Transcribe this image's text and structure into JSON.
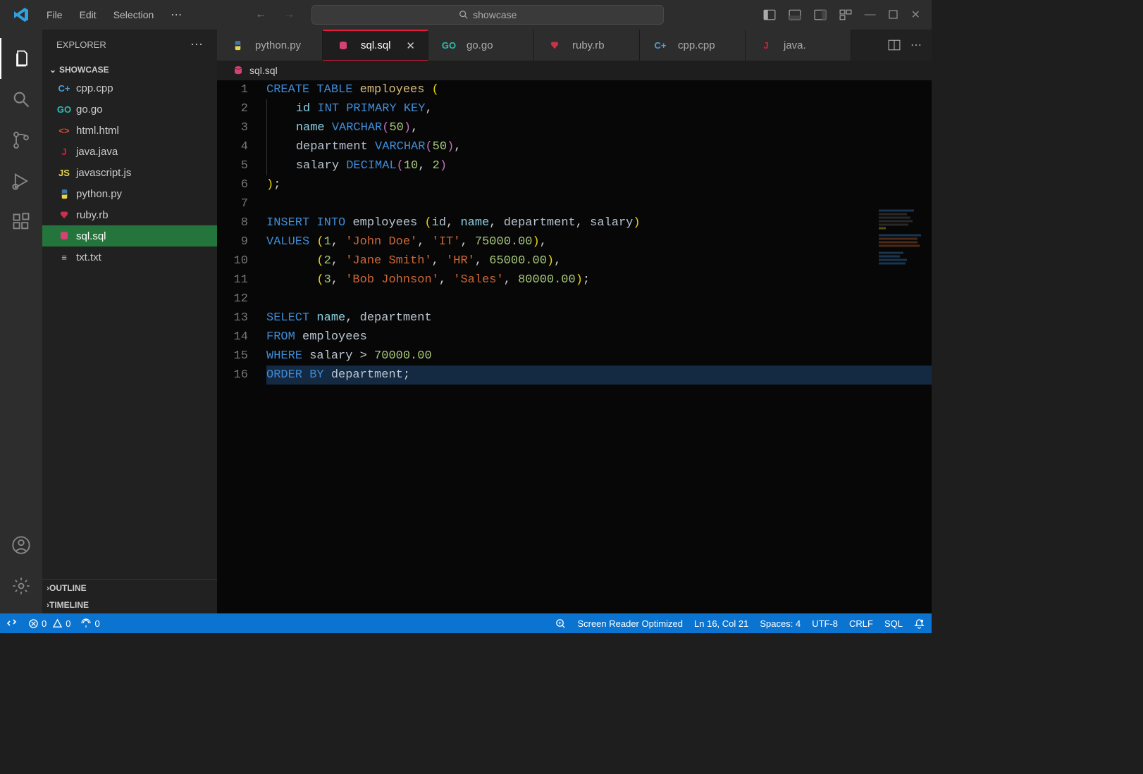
{
  "menu": {
    "file": "File",
    "edit": "Edit",
    "selection": "Selection"
  },
  "search_placeholder": "showcase",
  "explorer": {
    "title": "EXPLORER",
    "section": "SHOWCASE",
    "files": [
      {
        "name": "cpp.cpp",
        "icon": "C+",
        "icon_color": "#4b9fd6"
      },
      {
        "name": "go.go",
        "icon": "GO",
        "icon_color": "#29beb0"
      },
      {
        "name": "html.html",
        "icon": "<>",
        "icon_color": "#e44d26"
      },
      {
        "name": "java.java",
        "icon": "J",
        "icon_color": "#e11b3c"
      },
      {
        "name": "javascript.js",
        "icon": "JS",
        "icon_color": "#e8d44e"
      },
      {
        "name": "python.py",
        "icon": "py",
        "icon_color": "#3f76a8"
      },
      {
        "name": "ruby.rb",
        "icon": "rb",
        "icon_color": "#c8324a"
      },
      {
        "name": "sql.sql",
        "icon": "db",
        "icon_color": "#d84174"
      },
      {
        "name": "txt.txt",
        "icon": "≡",
        "icon_color": "#bbb"
      }
    ],
    "outline": "OUTLINE",
    "timeline": "TIMELINE"
  },
  "tabs": [
    {
      "name": "python.py",
      "icon_color": "#3f76a8"
    },
    {
      "name": "sql.sql",
      "icon_color": "#d84174"
    },
    {
      "name": "go.go",
      "icon_color": "#29beb0"
    },
    {
      "name": "ruby.rb",
      "icon_color": "#c8324a"
    },
    {
      "name": "cpp.cpp",
      "icon_color": "#4b9fd6"
    },
    {
      "name": "java.",
      "icon_color": "#e11b3c"
    }
  ],
  "breadcrumb": "sql.sql",
  "code": {
    "lines": 16,
    "tokens": [
      [
        [
          "CREATE",
          "kw"
        ],
        [
          " ",
          "ws"
        ],
        [
          "TABLE",
          "kw"
        ],
        [
          " ",
          "ws"
        ],
        [
          "employees",
          "name"
        ],
        [
          " ",
          "ws"
        ],
        [
          "(",
          "paren"
        ]
      ],
      [
        [
          "    ",
          "ig"
        ],
        [
          "id",
          "col"
        ],
        [
          " ",
          "ws"
        ],
        [
          "INT",
          "type"
        ],
        [
          " ",
          "ws"
        ],
        [
          "PRIMARY",
          "type"
        ],
        [
          " ",
          "ws"
        ],
        [
          "KEY",
          "type"
        ],
        [
          ",",
          "comma"
        ]
      ],
      [
        [
          "    ",
          "ig"
        ],
        [
          "name",
          "col"
        ],
        [
          " ",
          "ws"
        ],
        [
          "VARCHAR",
          "type"
        ],
        [
          "(",
          "paren2"
        ],
        [
          "50",
          "num"
        ],
        [
          ")",
          "paren2"
        ],
        [
          ",",
          "comma"
        ]
      ],
      [
        [
          "    ",
          "ig"
        ],
        [
          "department",
          "ident"
        ],
        [
          " ",
          "ws"
        ],
        [
          "VARCHAR",
          "type"
        ],
        [
          "(",
          "paren2"
        ],
        [
          "50",
          "num"
        ],
        [
          ")",
          "paren2"
        ],
        [
          ",",
          "comma"
        ]
      ],
      [
        [
          "    ",
          "ig"
        ],
        [
          "salary",
          "ident"
        ],
        [
          " ",
          "ws"
        ],
        [
          "DECIMAL",
          "type"
        ],
        [
          "(",
          "paren2"
        ],
        [
          "10",
          "num"
        ],
        [
          ",",
          "comma"
        ],
        [
          " ",
          "ws"
        ],
        [
          "2",
          "num"
        ],
        [
          ")",
          "paren2"
        ]
      ],
      [
        [
          ")",
          "paren"
        ],
        [
          ";",
          "comma"
        ]
      ],
      [],
      [
        [
          "INSERT",
          "kw"
        ],
        [
          " ",
          "ws"
        ],
        [
          "INTO",
          "kw"
        ],
        [
          " ",
          "ws"
        ],
        [
          "employees",
          "ident"
        ],
        [
          " ",
          "ws"
        ],
        [
          "(",
          "paren"
        ],
        [
          "id",
          "ident"
        ],
        [
          ",",
          "comma"
        ],
        [
          " ",
          "ws"
        ],
        [
          "name",
          "col"
        ],
        [
          ",",
          "comma"
        ],
        [
          " ",
          "ws"
        ],
        [
          "department",
          "ident"
        ],
        [
          ",",
          "comma"
        ],
        [
          " ",
          "ws"
        ],
        [
          "salary",
          "ident"
        ],
        [
          ")",
          "paren"
        ]
      ],
      [
        [
          "VALUES",
          "kw"
        ],
        [
          " ",
          "ws"
        ],
        [
          "(",
          "paren"
        ],
        [
          "1",
          "num"
        ],
        [
          ",",
          "comma"
        ],
        [
          " ",
          "ws"
        ],
        [
          "'John Doe'",
          "str"
        ],
        [
          ",",
          "comma"
        ],
        [
          " ",
          "ws"
        ],
        [
          "'IT'",
          "str"
        ],
        [
          ",",
          "comma"
        ],
        [
          " ",
          "ws"
        ],
        [
          "75000.00",
          "num"
        ],
        [
          ")",
          "paren"
        ],
        [
          ",",
          "comma"
        ]
      ],
      [
        [
          "       ",
          "ws"
        ],
        [
          "(",
          "paren"
        ],
        [
          "2",
          "num"
        ],
        [
          ",",
          "comma"
        ],
        [
          " ",
          "ws"
        ],
        [
          "'Jane Smith'",
          "str"
        ],
        [
          ",",
          "comma"
        ],
        [
          " ",
          "ws"
        ],
        [
          "'HR'",
          "str"
        ],
        [
          ",",
          "comma"
        ],
        [
          " ",
          "ws"
        ],
        [
          "65000.00",
          "num"
        ],
        [
          ")",
          "paren"
        ],
        [
          ",",
          "comma"
        ]
      ],
      [
        [
          "       ",
          "ws"
        ],
        [
          "(",
          "paren"
        ],
        [
          "3",
          "num"
        ],
        [
          ",",
          "comma"
        ],
        [
          " ",
          "ws"
        ],
        [
          "'Bob Johnson'",
          "str"
        ],
        [
          ",",
          "comma"
        ],
        [
          " ",
          "ws"
        ],
        [
          "'Sales'",
          "str"
        ],
        [
          ",",
          "comma"
        ],
        [
          " ",
          "ws"
        ],
        [
          "80000.00",
          "num"
        ],
        [
          ")",
          "paren"
        ],
        [
          ";",
          "comma"
        ]
      ],
      [],
      [
        [
          "SELECT",
          "kw"
        ],
        [
          " ",
          "ws"
        ],
        [
          "name",
          "col"
        ],
        [
          ",",
          "comma"
        ],
        [
          " ",
          "ws"
        ],
        [
          "department",
          "ident"
        ]
      ],
      [
        [
          "FROM",
          "kw"
        ],
        [
          " ",
          "ws"
        ],
        [
          "employees",
          "ident"
        ]
      ],
      [
        [
          "WHERE",
          "kw"
        ],
        [
          " ",
          "ws"
        ],
        [
          "salary",
          "ident"
        ],
        [
          " > ",
          "ws"
        ],
        [
          "70000.00",
          "num"
        ]
      ],
      [
        [
          "ORDER",
          "kw"
        ],
        [
          " ",
          "ws"
        ],
        [
          "BY",
          "kw"
        ],
        [
          " ",
          "ws"
        ],
        [
          "department",
          "ident"
        ],
        [
          ";",
          "comma"
        ]
      ]
    ]
  },
  "status": {
    "errors": "0",
    "warnings": "0",
    "ports": "0",
    "reader": "Screen Reader Optimized",
    "pos": "Ln 16, Col 21",
    "spaces": "Spaces: 4",
    "encoding": "UTF-8",
    "eol": "CRLF",
    "lang": "SQL"
  }
}
